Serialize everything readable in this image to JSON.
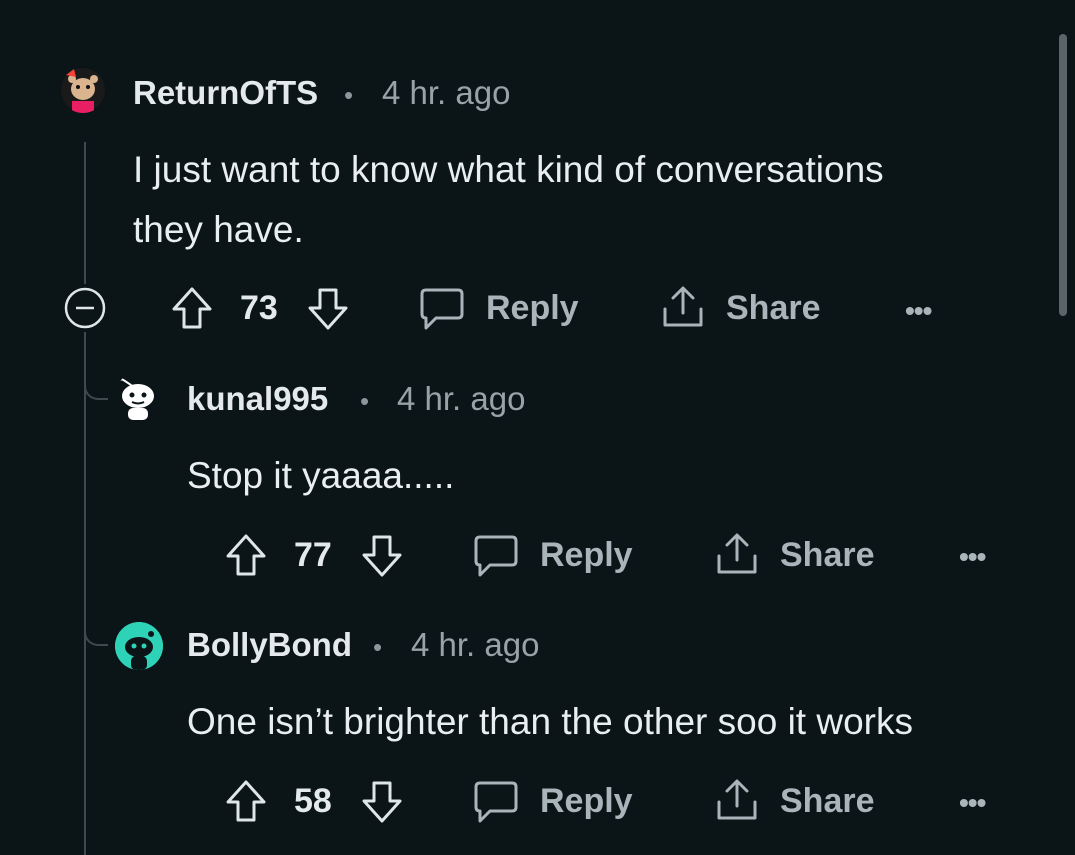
{
  "comments": [
    {
      "username": "ReturnOfTS",
      "time": "4 hr. ago",
      "body_line1": "I just want to know what kind of conversations",
      "body_line2": "they have.",
      "score": "73",
      "reply_label": "Reply",
      "share_label": "Share",
      "more_label": "•••"
    },
    {
      "username": "kunal995",
      "time": "4 hr. ago",
      "body": "Stop it yaaaa.....",
      "score": "77",
      "reply_label": "Reply",
      "share_label": "Share",
      "more_label": "•••"
    },
    {
      "username": "BollyBond",
      "time": "4 hr. ago",
      "body": "One isn’t brighter than the other soo it works",
      "score": "58",
      "reply_label": "Reply",
      "share_label": "Share",
      "more_label": "•••"
    }
  ],
  "separator": "•",
  "colors": {
    "background": "#0b1416",
    "bolly_avatar": "#2ed3b7",
    "thread_line": "#3e4a4f"
  }
}
